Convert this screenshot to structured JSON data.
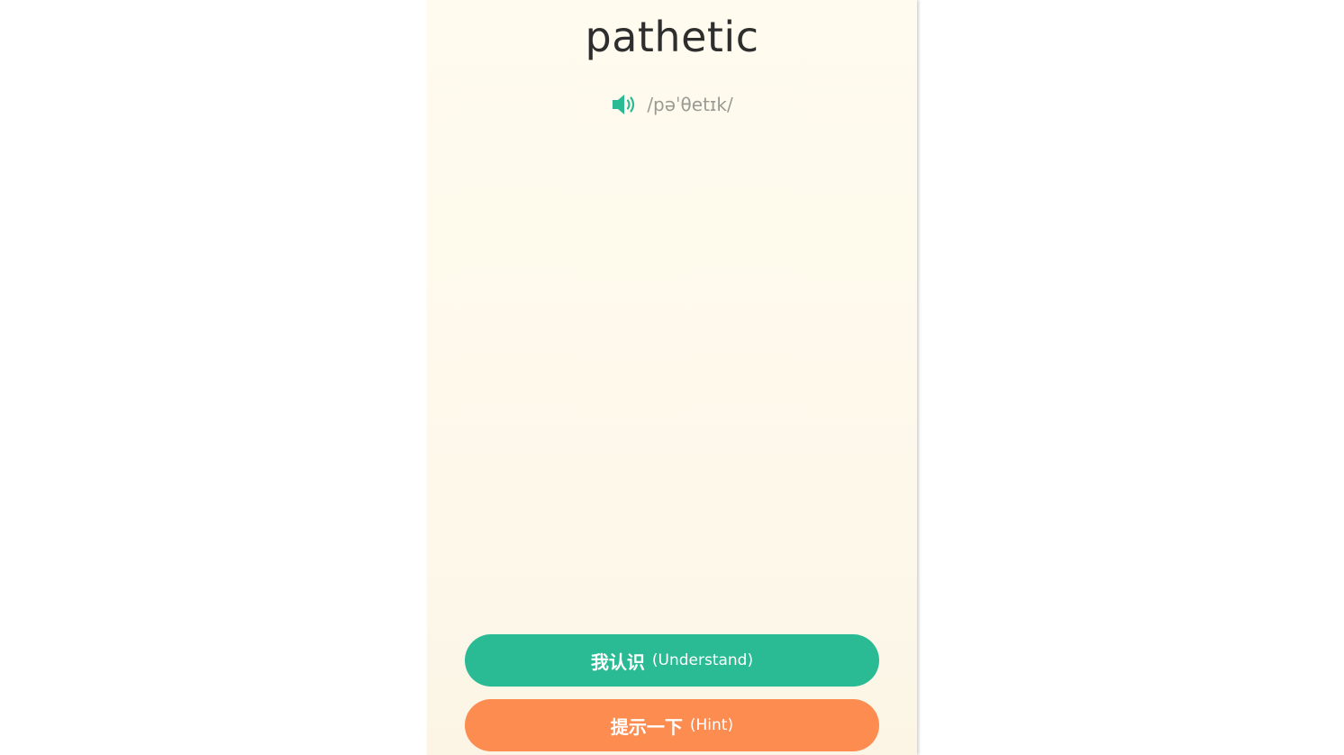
{
  "card": {
    "word": "pathetic",
    "phonetic": "/pəˈθetɪk/",
    "speaker_icon": "speaker-volume-icon"
  },
  "actions": {
    "understand": {
      "zh": "我认识",
      "en": "(Understand)"
    },
    "hint": {
      "zh": "提示一下",
      "en": "(Hint)"
    }
  },
  "colors": {
    "accent_green": "#2bbb94",
    "accent_orange": "#fd8c51",
    "card_background": "#fffbee",
    "word_text": "#2e2e2e",
    "phonetic_text": "#9a9a94"
  }
}
